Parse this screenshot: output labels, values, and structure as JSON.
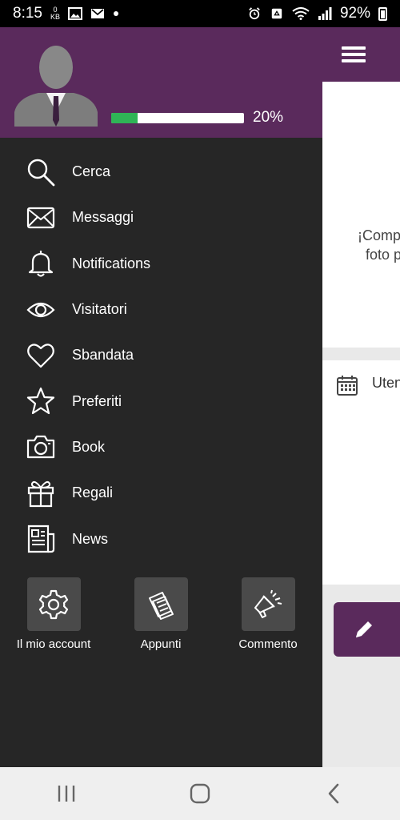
{
  "status_bar": {
    "time": "8:15",
    "data_rate_value": "0",
    "data_rate_unit": "KB",
    "battery": "92%",
    "icons": [
      "image-icon",
      "mail-icon",
      "dot-icon",
      "alarm-icon",
      "recycle-icon",
      "wifi-icon",
      "signal-icon",
      "battery-icon"
    ]
  },
  "drawer": {
    "header": {
      "avatar": "avatar-silhouette-icon",
      "progress": 0.2,
      "progress_label": "20%",
      "colors": {
        "header_bg": "#5a2a5c",
        "progress_fill": "#2fb456",
        "progress_track": "#ffffff"
      }
    },
    "menu": [
      {
        "label": "Cerca",
        "icon": "search-icon"
      },
      {
        "label": "Messaggi",
        "icon": "mail-icon"
      },
      {
        "label": "Notifications",
        "icon": "bell-icon"
      },
      {
        "label": "Visitatori",
        "icon": "eye-icon"
      },
      {
        "label": "Sbandata",
        "icon": "heart-icon"
      },
      {
        "label": "Preferiti",
        "icon": "star-icon"
      },
      {
        "label": "Book",
        "icon": "camera-icon"
      },
      {
        "label": "Regali",
        "icon": "gift-icon"
      },
      {
        "label": "News",
        "icon": "newspaper-icon"
      }
    ],
    "quick_actions": [
      {
        "label": "Il mio account",
        "icon": "gear-icon"
      },
      {
        "label": "Appunti",
        "icon": "notes-icon"
      },
      {
        "label": "Commento",
        "icon": "megaphone-icon"
      }
    ],
    "bg_color": "#262626"
  },
  "background_app": {
    "app_bar_color": "#5a2a5c",
    "card_text_line1": "¡Comp",
    "card_text_line2": "foto p",
    "section_label": "Uten"
  },
  "nav_bar": {
    "buttons": [
      "recents-button",
      "home-button",
      "back-button"
    ]
  }
}
